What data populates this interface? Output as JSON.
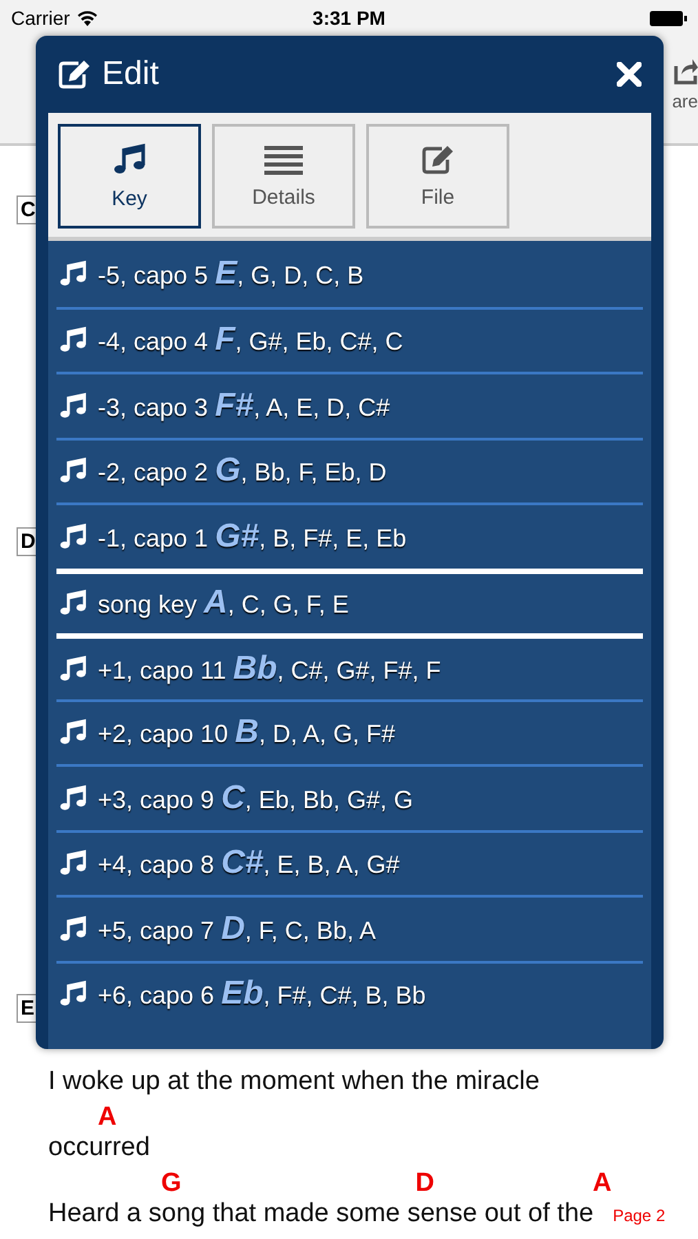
{
  "status_bar": {
    "carrier": "Carrier",
    "time": "3:31 PM"
  },
  "toolbar": {
    "share_label": "are"
  },
  "sections": [
    "C",
    "D",
    "E"
  ],
  "lyrics": [
    {
      "text": "I woke up at the moment when the miracle"
    },
    {
      "chords": [
        "A"
      ],
      "text": "occurred"
    },
    {
      "chords": [
        "G",
        "D",
        "A"
      ],
      "text": "Heard a song that made some sense out of the"
    }
  ],
  "page_label": "Page 2",
  "dialog": {
    "title": "Edit",
    "tabs": [
      {
        "label": "Key",
        "kind": "note",
        "selected": true
      },
      {
        "label": "Details",
        "kind": "lines",
        "selected": false
      },
      {
        "label": "File",
        "kind": "edit",
        "selected": false
      }
    ],
    "keys": [
      {
        "kind": "transpose",
        "label": "-5, capo 5 *E*, G, D, C, B"
      },
      {
        "kind": "transpose",
        "label": "-4, capo 4 *F*, G#, Eb, C#, C"
      },
      {
        "kind": "transpose",
        "label": "-3, capo 3 *F#*, A, E, D, C#"
      },
      {
        "kind": "transpose",
        "label": "-2, capo 2 *G*, Bb, F, Eb, D"
      },
      {
        "kind": "transpose",
        "label": "-1, capo 1 *G#*, B, F#, E, Eb"
      },
      {
        "kind": "original",
        "label": "song key *A*, C, G, F, E"
      },
      {
        "kind": "transpose",
        "label": "+1, capo 11 *Bb*, C#, G#, F#, F"
      },
      {
        "kind": "transpose",
        "label": "+2, capo 10 *B*, D, A, G, F#"
      },
      {
        "kind": "transpose",
        "label": "+3, capo 9 *C*, Eb, Bb, G#, G"
      },
      {
        "kind": "transpose",
        "label": "+4, capo 8 *C#*, E, B, A, G#"
      },
      {
        "kind": "transpose",
        "label": "+5, capo 7 *D*, F, C, Bb, A"
      },
      {
        "kind": "transpose",
        "label": "+6, capo 6 *Eb*, F#, C#, B, Bb"
      }
    ]
  }
}
